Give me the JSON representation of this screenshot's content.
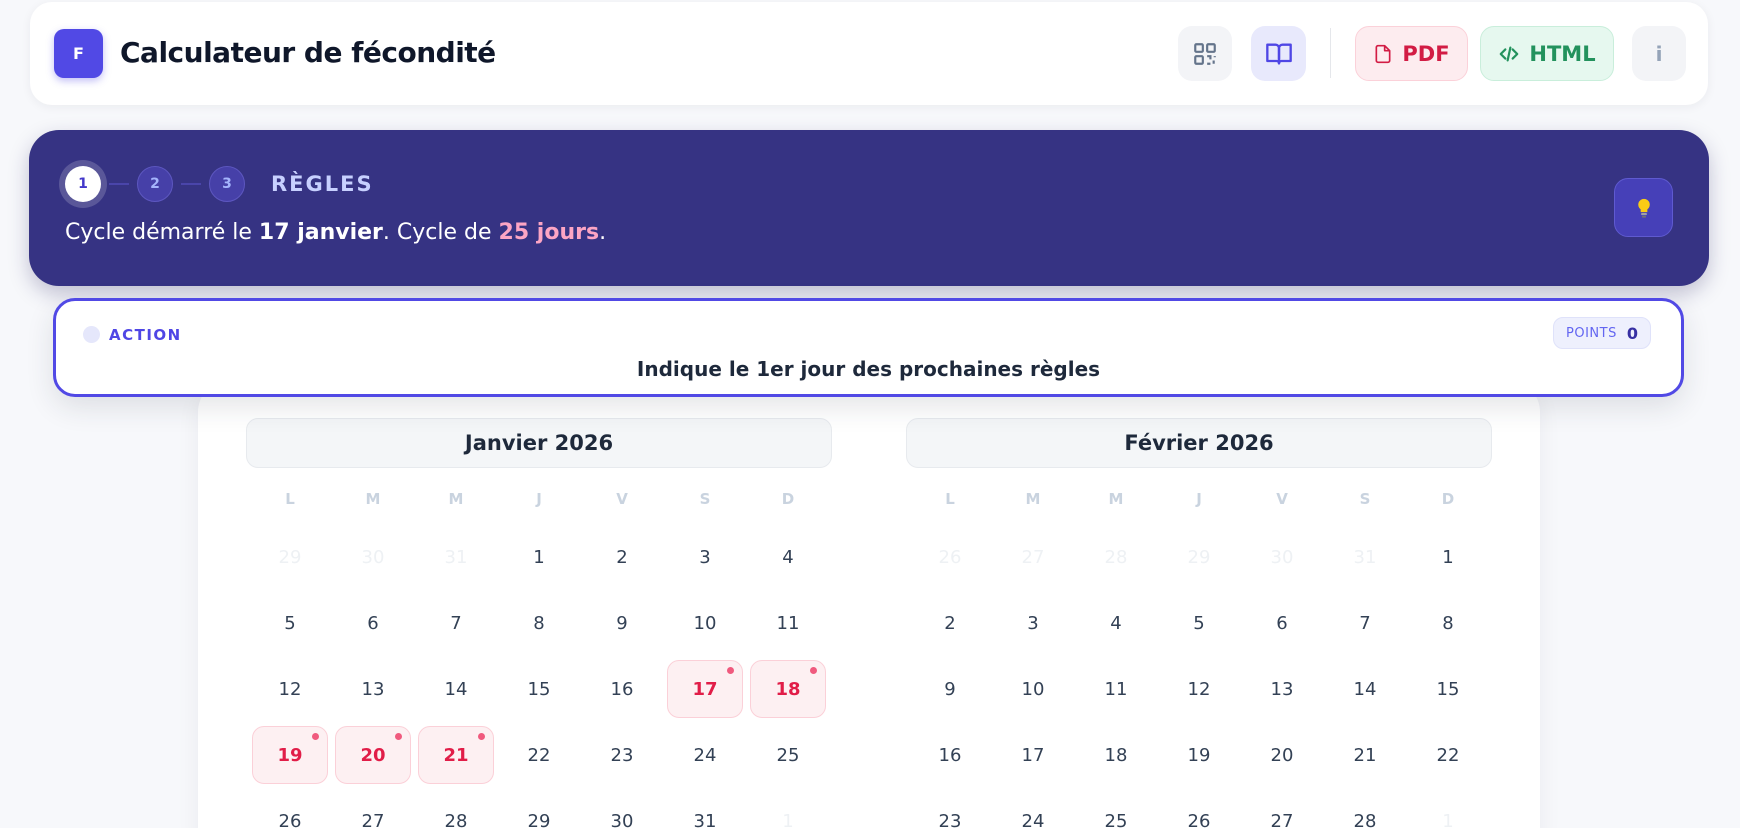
{
  "header": {
    "logo_letter": "F",
    "title": "Calculateur de fécondité",
    "buttons": {
      "qr_icon": "qr-code-icon",
      "book_icon": "book-icon",
      "pdf_label": "PDF",
      "html_label": "HTML",
      "info_label": "i"
    }
  },
  "banner": {
    "steps": [
      "1",
      "2",
      "3"
    ],
    "active_step": 1,
    "step_title": "RÈGLES",
    "text_prefix": "Cycle démarré le ",
    "start_date": "17 janvier",
    "text_middle": ". Cycle de ",
    "cycle_length": "25 jours",
    "text_suffix": ".",
    "hint_icon": "lightbulb-icon"
  },
  "action": {
    "label": "ACTION",
    "points_label": "POINTS",
    "points_value": "0",
    "instruction": "Indique le 1er jour des prochaines règles"
  },
  "calendar": {
    "weekdays": [
      "L",
      "M",
      "M",
      "J",
      "V",
      "S",
      "D"
    ],
    "months": [
      {
        "title": "Janvier 2026",
        "days": [
          {
            "d": "29",
            "muted": true
          },
          {
            "d": "30",
            "muted": true
          },
          {
            "d": "31",
            "muted": true
          },
          {
            "d": "1"
          },
          {
            "d": "2"
          },
          {
            "d": "3"
          },
          {
            "d": "4"
          },
          {
            "d": "5"
          },
          {
            "d": "6"
          },
          {
            "d": "7"
          },
          {
            "d": "8"
          },
          {
            "d": "9"
          },
          {
            "d": "10"
          },
          {
            "d": "11"
          },
          {
            "d": "12"
          },
          {
            "d": "13"
          },
          {
            "d": "14"
          },
          {
            "d": "15"
          },
          {
            "d": "16"
          },
          {
            "d": "17",
            "period": true
          },
          {
            "d": "18",
            "period": true
          },
          {
            "d": "19",
            "period": true
          },
          {
            "d": "20",
            "period": true
          },
          {
            "d": "21",
            "period": true
          },
          {
            "d": "22"
          },
          {
            "d": "23"
          },
          {
            "d": "24"
          },
          {
            "d": "25"
          },
          {
            "d": "26"
          },
          {
            "d": "27"
          },
          {
            "d": "28"
          },
          {
            "d": "29"
          },
          {
            "d": "30"
          },
          {
            "d": "31"
          },
          {
            "d": "1",
            "muted": true
          }
        ]
      },
      {
        "title": "Février 2026",
        "days": [
          {
            "d": "26",
            "muted": true
          },
          {
            "d": "27",
            "muted": true
          },
          {
            "d": "28",
            "muted": true
          },
          {
            "d": "29",
            "muted": true
          },
          {
            "d": "30",
            "muted": true
          },
          {
            "d": "31",
            "muted": true
          },
          {
            "d": "1"
          },
          {
            "d": "2"
          },
          {
            "d": "3"
          },
          {
            "d": "4"
          },
          {
            "d": "5"
          },
          {
            "d": "6"
          },
          {
            "d": "7"
          },
          {
            "d": "8"
          },
          {
            "d": "9"
          },
          {
            "d": "10"
          },
          {
            "d": "11"
          },
          {
            "d": "12"
          },
          {
            "d": "13"
          },
          {
            "d": "14"
          },
          {
            "d": "15"
          },
          {
            "d": "16"
          },
          {
            "d": "17"
          },
          {
            "d": "18"
          },
          {
            "d": "19"
          },
          {
            "d": "20"
          },
          {
            "d": "21"
          },
          {
            "d": "22"
          },
          {
            "d": "23"
          },
          {
            "d": "24"
          },
          {
            "d": "25"
          },
          {
            "d": "26"
          },
          {
            "d": "27"
          },
          {
            "d": "28"
          },
          {
            "d": "1",
            "muted": true
          }
        ]
      }
    ]
  },
  "colors": {
    "accent": "#5149e5",
    "banner_bg": "#363383",
    "period_text": "#e11d48",
    "pdf": "#d21c44",
    "html": "#23925d"
  }
}
